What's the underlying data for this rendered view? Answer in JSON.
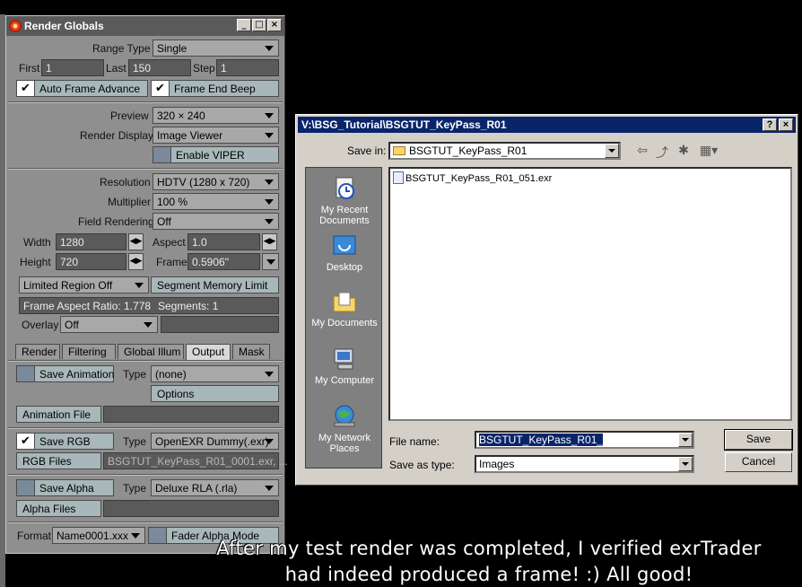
{
  "render_globals": {
    "title": "Render Globals",
    "window_buttons": [
      "_",
      "□",
      "×"
    ],
    "range_type_label": "Range Type",
    "range_type_value": "Single",
    "first_label": "First",
    "first_value": "1",
    "last_label": "Last",
    "last_value": "150",
    "step_label": "Step",
    "step_value": "1",
    "auto_frame_advance": "Auto Frame Advance",
    "frame_end_beep": "Frame End Beep",
    "preview_label": "Preview",
    "preview_value": "320 × 240",
    "render_display_label": "Render Display",
    "render_display_value": "Image Viewer",
    "enable_viper": "Enable VIPER",
    "resolution_label": "Resolution",
    "resolution_value": "HDTV (1280 x 720)",
    "multiplier_label": "Multiplier",
    "multiplier_value": "100 %",
    "field_rendering_label": "Field Rendering",
    "field_rendering_value": "Off",
    "width_label": "Width",
    "width_value": "1280",
    "height_label": "Height",
    "height_value": "720",
    "aspect_label": "Aspect",
    "aspect_value": "1.0",
    "frame_label": "Frame",
    "frame_value": "0.5906\"",
    "limited_region": "Limited Region Off",
    "segment_memory_limit": "Segment Memory Limit",
    "frame_aspect_ratio": "Frame Aspect Ratio: 1.778",
    "segments": "Segments: 1",
    "overlay_label": "Overlay",
    "overlay_value": "Off",
    "tabs": [
      "Render",
      "Filtering",
      "Global Illum",
      "Output",
      "Mask"
    ],
    "active_tab": "Output",
    "save_animation": "Save Animation",
    "type_label": "Type",
    "animation_type_value": "(none)",
    "options": "Options",
    "animation_file": "Animation File",
    "save_rgb": "Save RGB",
    "rgb_type_value": "OpenEXR Dummy(.exr)",
    "rgb_files": "RGB Files",
    "rgb_files_value": "BSGTUT_KeyPass_R01_0001.exr, ...",
    "save_alpha": "Save Alpha",
    "alpha_type_value": "Deluxe RLA (.rla)",
    "alpha_files": "Alpha Files",
    "format_label": "Format",
    "format_value": "Name0001.xxx",
    "fader_alpha_mode": "Fader Alpha Mode"
  },
  "save_dialog": {
    "title": "V:\\BSG_Tutorial\\BSGTUT_KeyPass_R01",
    "help_button": "?",
    "close_button": "×",
    "save_in_label": "Save in:",
    "save_in_value": "BSGTUT_KeyPass_R01",
    "places": [
      {
        "label": "My Recent Documents",
        "icon": "recent-documents-icon"
      },
      {
        "label": "Desktop",
        "icon": "desktop-icon"
      },
      {
        "label": "My Documents",
        "icon": "my-documents-icon"
      },
      {
        "label": "My Computer",
        "icon": "my-computer-icon"
      },
      {
        "label": "My Network Places",
        "icon": "network-places-icon"
      }
    ],
    "files": [
      "BSGTUT_KeyPass_R01_051.exr"
    ],
    "file_name_label": "File name:",
    "file_name_value": "BSGTUT_KeyPass_R01_",
    "save_as_type_label": "Save as type:",
    "save_as_type_value": "Images",
    "save_button": "Save",
    "cancel_button": "Cancel"
  },
  "caption": {
    "line1": "After my test render was completed, I verified exrTrader",
    "line2": "had indeed produced a frame! :) All good!"
  }
}
